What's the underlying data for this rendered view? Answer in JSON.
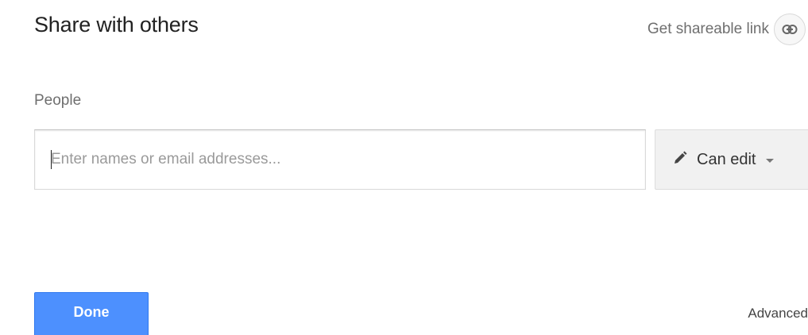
{
  "dialog": {
    "title": "Share with others",
    "shareable_link_label": "Get shareable link"
  },
  "people": {
    "label": "People",
    "input_placeholder": "Enter names or email addresses...",
    "input_value": ""
  },
  "permission": {
    "selected": "Can edit",
    "icon": "pencil-icon"
  },
  "footer": {
    "done_label": "Done",
    "advanced_label": "Advanced"
  },
  "colors": {
    "primary_button": "#4d90fe",
    "permission_bg": "#f1f1f1"
  }
}
